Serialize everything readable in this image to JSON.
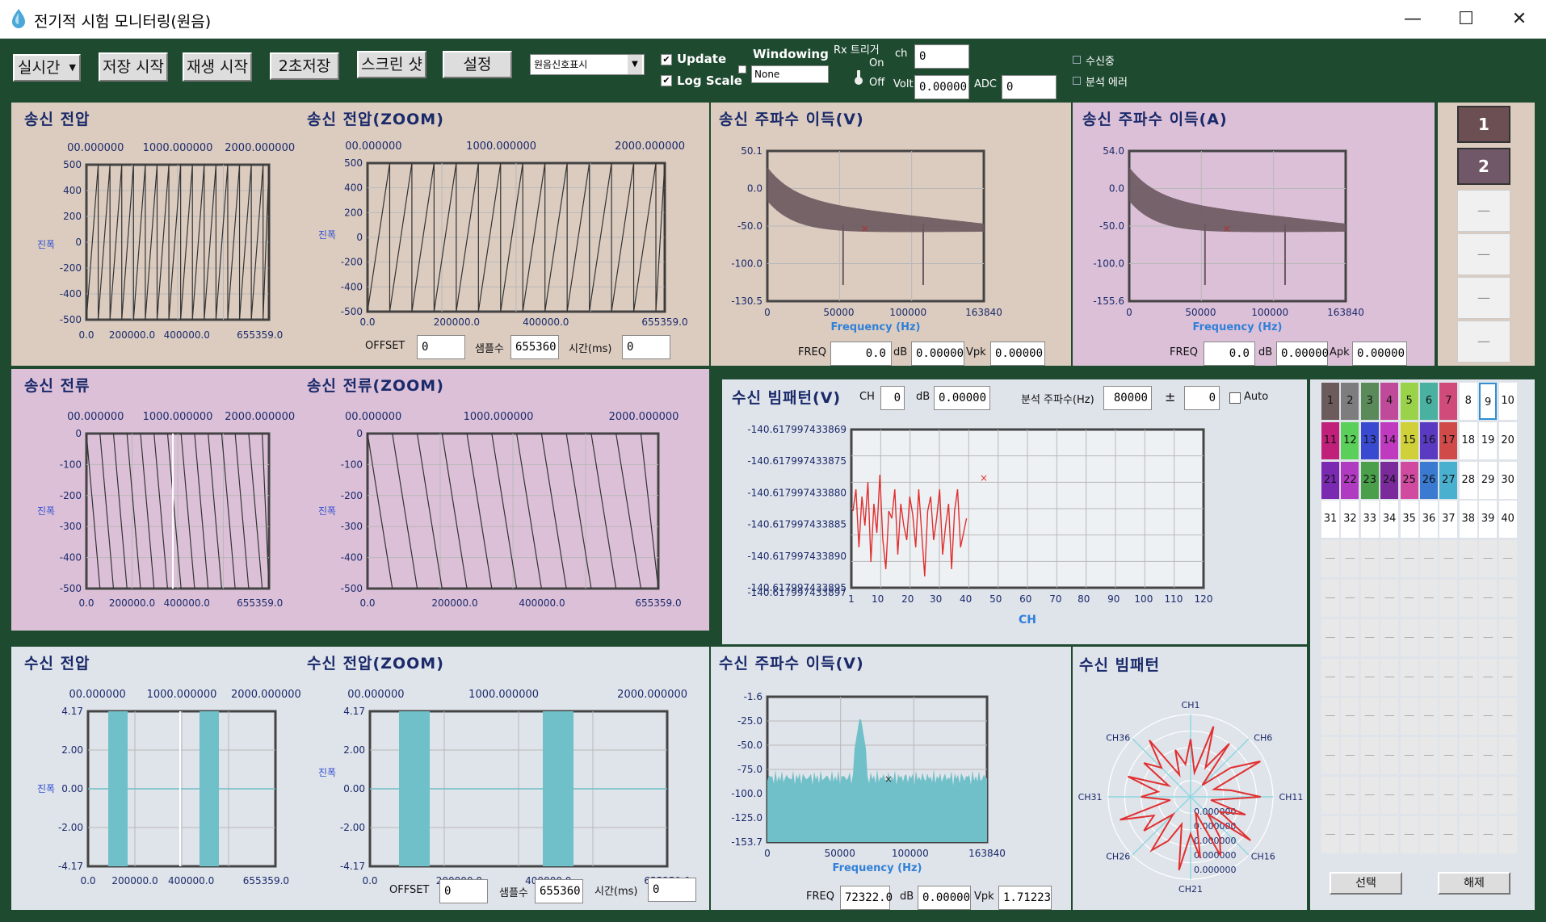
{
  "window": {
    "title": "전기적 시험 모니터링(원음)",
    "min": "—",
    "max": "☐",
    "close": "✕"
  },
  "toolbar": {
    "mode": "실시간",
    "save_start": "저장 시작",
    "play_start": "재생 시작",
    "save_2s": "2초저장",
    "screenshot": "스크린 샷",
    "settings": "설정",
    "signal_select": "원음신호표시",
    "update": "Update",
    "log_scale": "Log Scale",
    "windowing": "Windowing",
    "windowing_value": "None",
    "rx_trigger": "Rx 트리거",
    "on": "On",
    "off": "Off",
    "ch_label": "ch",
    "ch_value": "0",
    "volt_label": "Volt",
    "volt_value": "0.00000",
    "adc_label": "ADC",
    "adc_value": "0",
    "receiving": "수신중",
    "analysis_error": "분석 에러"
  },
  "tx_voltage": {
    "title": "송신 전압",
    "zoom_title": "송신 전압(ZOOM)",
    "top_ticks": [
      "00.000000",
      "1000.000000",
      "2000.000000"
    ],
    "y_ticks": [
      "500",
      "400",
      "200",
      "0",
      "-200",
      "-400",
      "-500"
    ],
    "x_ticks": [
      "0.0",
      "200000.0",
      "400000.0",
      "655359.0"
    ],
    "zoom_x_ticks": [
      "0.0",
      "200000.0",
      "400000.0",
      "655359.0"
    ],
    "ylabel": "진폭",
    "offset_label": "OFFSET",
    "offset_value": "0",
    "samples_label": "샘플수",
    "samples_value": "655360",
    "time_label": "시간(ms)",
    "time_value": "0"
  },
  "tx_freq_v": {
    "title": "송신 주파수 이득(V)",
    "y_ticks": [
      "50.1",
      "0.0",
      "-50.0",
      "-100.0",
      "-130.5"
    ],
    "x_ticks": [
      "0",
      "50000",
      "100000",
      "163840"
    ],
    "xlabel": "Frequency (Hz)",
    "freq_label": "FREQ",
    "freq_value": "0.0",
    "db_label": "dB",
    "db_value": "0.00000",
    "v_label": "Vpk",
    "v_value": "0.00000"
  },
  "tx_freq_a": {
    "title": "송신 주파수 이득(A)",
    "y_ticks": [
      "54.0",
      "0.0",
      "-50.0",
      "-100.0",
      "-155.6"
    ],
    "x_ticks": [
      "0",
      "50000",
      "100000",
      "163840"
    ],
    "xlabel": "Frequency (Hz)",
    "freq_label": "FREQ",
    "freq_value": "0.0",
    "db_label": "dB",
    "db_value": "0.00000",
    "a_label": "Apk",
    "a_value": "0.00000"
  },
  "side_buttons": {
    "b1": "1",
    "b2": "2",
    "b3": "—",
    "b4": "—",
    "b5": "—",
    "b6": "—"
  },
  "tx_current": {
    "title": "송신 전류",
    "zoom_title": "송신 전류(ZOOM)",
    "top_ticks": [
      "00.000000",
      "1000.000000",
      "2000.000000"
    ],
    "y_ticks": [
      "0",
      "-100",
      "-200",
      "-300",
      "-400",
      "-500"
    ],
    "x_ticks": [
      "0.0",
      "200000.0",
      "400000.0",
      "655359.0"
    ],
    "ylabel": "진폭"
  },
  "rx_beam": {
    "title": "수신 빔패턴(V)",
    "ch_label": "CH",
    "ch_value": "0",
    "db_label": "dB",
    "db_value": "0.00000",
    "af_label": "분석 주파수(Hz)",
    "af_value": "80000",
    "pm": "±",
    "pm_value": "0",
    "auto": "Auto",
    "y_ticks": [
      "-140.617997433869",
      "-140.617997433875",
      "-140.617997433880",
      "-140.617997433885",
      "-140.617997433890",
      "-140.617997433895",
      "-140.617997433897"
    ],
    "x_ticks": [
      "1",
      "10",
      "20",
      "30",
      "40",
      "50",
      "60",
      "70",
      "80",
      "90",
      "100",
      "110",
      "120"
    ],
    "xlabel": "CH"
  },
  "rx_voltage": {
    "title": "수신 전압",
    "zoom_title": "수신 전압(ZOOM)",
    "top_ticks": [
      "00.000000",
      "1000.000000",
      "2000.000000"
    ],
    "y_ticks": [
      "4.17",
      "2.00",
      "0.00",
      "-2.00",
      "-4.17"
    ],
    "x_ticks": [
      "0.0",
      "200000.0",
      "400000.0",
      "655359.0"
    ],
    "ylabel": "진폭",
    "offset_label": "OFFSET",
    "offset_value": "0",
    "samples_label": "샘플수",
    "samples_value": "655360",
    "time_label": "시간(ms)",
    "time_value": "0"
  },
  "rx_freq_v": {
    "title": "수신 주파수 이득(V)",
    "y_ticks": [
      "-1.6",
      "-25.0",
      "-50.0",
      "-75.0",
      "-100.0",
      "-125.0",
      "-153.7"
    ],
    "x_ticks": [
      "0",
      "50000",
      "100000",
      "163840"
    ],
    "xlabel": "Frequency (Hz)",
    "freq_label": "FREQ",
    "freq_value": "72322.0",
    "db_label": "dB",
    "db_value": "0.00000",
    "v_label": "Vpk",
    "v_value": "1.71223"
  },
  "rx_polar": {
    "title": "수신 빔패턴",
    "labels": [
      "CH1",
      "CH6",
      "CH11",
      "CH16",
      "CH21",
      "CH26",
      "CH31",
      "CH36"
    ],
    "radial": [
      "0.000000",
      "0.000000",
      "0.000000",
      "0.000000",
      "0.000000"
    ]
  },
  "channel_grid": {
    "cells": [
      "1",
      "2",
      "3",
      "4",
      "5",
      "6",
      "7",
      "8",
      "9",
      "10",
      "11",
      "12",
      "13",
      "14",
      "15",
      "16",
      "17",
      "18",
      "19",
      "20",
      "21",
      "22",
      "23",
      "24",
      "25",
      "26",
      "27",
      "28",
      "29",
      "30",
      "31",
      "32",
      "33",
      "34",
      "35",
      "36",
      "37",
      "38",
      "39",
      "40"
    ],
    "colors": [
      "#6b5b5b",
      "#7d7d7d",
      "#5a8a5a",
      "#c04a9a",
      "#9ad24a",
      "#4ab0a0",
      "#d04a7a",
      "#ffffff",
      "#ffffff",
      "#ffffff",
      "#c0207a",
      "#5ad05a",
      "#3a4ad0",
      "#c03ac0",
      "#d0d03a",
      "#5a3ac0",
      "#d04a4a",
      "#ffffff",
      "#ffffff",
      "#ffffff",
      "#7a2ab0",
      "#b03ac0",
      "#4aa04a",
      "#7a2a9a",
      "#d04aa0",
      "#3a7ad0",
      "#4ab0d0",
      "#ffffff",
      "#ffffff",
      "#ffffff"
    ],
    "select": "선택",
    "clear": "해제"
  }
}
